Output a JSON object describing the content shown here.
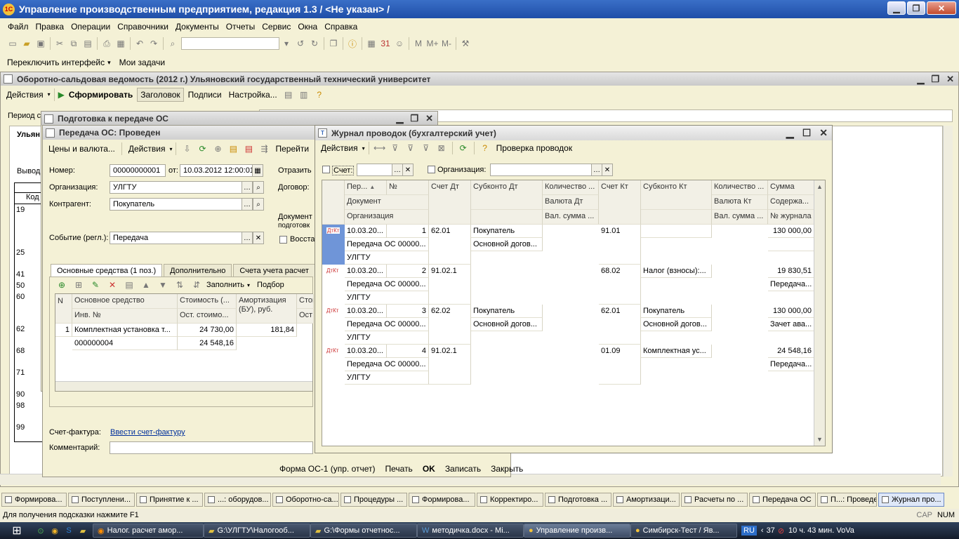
{
  "app": {
    "title": "Управление производственным предприятием, редакция 1.3 / <Не указан> /",
    "logo": "1С"
  },
  "menu": [
    "Файл",
    "Правка",
    "Операции",
    "Справочники",
    "Документы",
    "Отчеты",
    "Сервис",
    "Окна",
    "Справка"
  ],
  "toolbar2": {
    "switch_interface": "Переключить интерфейс",
    "my_tasks": "Мои задачи"
  },
  "osv": {
    "title": "Оборотно-сальдовая ведомость (2012 г.) Ульяновский государственный технический университет",
    "actions": "Действия",
    "generate": "Сформировать",
    "header_btn": "Заголовок",
    "signatures": "Подписи",
    "settings": "Настройка...",
    "period_label": "Период с",
    "org_prefix": "Ульян",
    "output_prefix": "Вывод",
    "code_header": "Код",
    "accounts": [
      "19",
      "25",
      "41",
      "50",
      "60",
      "62",
      "68",
      "71",
      "90",
      "98",
      "99"
    ]
  },
  "prep_os": {
    "title": "Подготовка к передаче ОС"
  },
  "transfer": {
    "title": "Передача ОС: Проведен",
    "toolbar": {
      "prices": "Цены и валюта...",
      "actions": "Действия",
      "post": "Перейти"
    },
    "number_label": "Номер:",
    "number": "00000000001",
    "date_label": "от:",
    "date": "10.03.2012 12:00:01",
    "reflect_label": "Отразить",
    "org_label": "Организация:",
    "org": "УЛГТУ",
    "contract_label": "Договор:",
    "counterparty_label": "Контрагент:",
    "counterparty": "Покупатель",
    "doc_label": "Документ",
    "doc_label2": "подготовк",
    "event_label": "Событие (регл.):",
    "event": "Передача",
    "restore_label": "Восста",
    "tabs": [
      "Основные средства (1 поз.)",
      "Дополнительно",
      "Счета учета расчет"
    ],
    "grid_toolbar": {
      "fill": "Заполнить",
      "selection": "Подбор"
    },
    "grid_headers": {
      "n": "N",
      "asset": "Основное средство",
      "inv": "Инв. №",
      "cost": "Стоимость (...",
      "residual": "Ост. стоимо...",
      "amort": "Амортизация (БУ), руб.",
      "cost2": "Стои",
      "residual2": "Ост"
    },
    "grid_rows": [
      {
        "n": "1",
        "asset": "Комплектная установка т...",
        "inv": "000000004",
        "cost": "24 730,00",
        "residual": "24 548,16",
        "amort": "181,84"
      }
    ],
    "invoice_label": "Счет-фактура:",
    "invoice_link": "Ввести счет-фактуру",
    "comment_label": "Комментарий:",
    "bottom": {
      "form": "Форма ОС-1 (упр. отчет)",
      "print": "Печать",
      "ok": "OK",
      "save": "Записать",
      "close": "Закрыть"
    }
  },
  "journal": {
    "title": "Журнал проводок (бухгалтерский учет)",
    "actions": "Действия",
    "check": "Проверка проводок",
    "account_label": "Счет:",
    "org_label": "Организация:",
    "headers": {
      "period": "Пер...",
      "num": "№",
      "doc": "Документ",
      "org": "Организация",
      "dt": "Счет Дт",
      "subdt": "Субконто Дт",
      "qtydt": "Количество ...",
      "curdt": "Валюта Дт",
      "valdt": "Вал. сумма ...",
      "kt": "Счет Кт",
      "subkt": "Субконто Кт",
      "qtykt": "Количество ...",
      "curkt": "Валюта Кт",
      "valkt": "Вал. сумма ...",
      "sum": "Сумма",
      "content": "Содержа...",
      "jnum": "№ журнала"
    },
    "rows": [
      {
        "period": "10.03.20...",
        "num": "1",
        "doc": "Передача ОС 00000...",
        "org": "УЛГТУ",
        "dt": "62.01",
        "subdt1": "Покупатель",
        "subdt2": "Основной догов...",
        "kt": "91.01",
        "subkt1": "",
        "subkt2": "",
        "sum": "130 000,00",
        "content": ""
      },
      {
        "period": "10.03.20...",
        "num": "2",
        "doc": "Передача ОС 00000...",
        "org": "УЛГТУ",
        "dt": "91.02.1",
        "subdt1": "",
        "subdt2": "",
        "kt": "68.02",
        "subkt1": "Налог (взносы):...",
        "subkt2": "",
        "sum": "19 830,51",
        "content": "Передача..."
      },
      {
        "period": "10.03.20...",
        "num": "3",
        "doc": "Передача ОС 00000...",
        "org": "УЛГТУ",
        "dt": "62.02",
        "subdt1": "Покупатель",
        "subdt2": "Основной догов...",
        "kt": "62.01",
        "subkt1": "Покупатель",
        "subkt2": "Основной догов...",
        "sum": "130 000,00",
        "content": "Зачет ава..."
      },
      {
        "period": "10.03.20...",
        "num": "4",
        "doc": "Передача ОС 00000...",
        "org": "УЛГТУ",
        "dt": "91.02.1",
        "subdt1": "",
        "subdt2": "",
        "kt": "01.09",
        "subkt1": "Комплектная ус...",
        "subkt2": "",
        "sum": "24 548,16",
        "content": "Передача..."
      }
    ]
  },
  "tasks": [
    "Формирова...",
    "Поступлени...",
    "Принятие к ...",
    "...: оборудов...",
    "Оборотно-са...",
    "Процедуры ...",
    "Формирова...",
    "Корректиро...",
    "Подготовка ...",
    "Амортизаци...",
    "Расчеты по ...",
    "Передача ОС",
    "П...: Проведен",
    "Журнал про..."
  ],
  "status": {
    "hint": "Для получения подсказки нажмите F1",
    "cap": "CAP",
    "num": "NUM"
  },
  "os_taskbar": {
    "items": [
      "Налог. расчет амор...",
      "G:\\УЛГТУ\\Налогооб...",
      "G:\\Формы отчетнос...",
      "методичка.docx - Mi...",
      "Управление произв...",
      "Симбирск-Тест / Яв..."
    ],
    "lang": "RU",
    "temp": "37",
    "clock": "10 ч. 43 мин. VoVa"
  },
  "colors": {
    "title_blue": "#1f4ea8",
    "selection": "#6f95d8"
  }
}
